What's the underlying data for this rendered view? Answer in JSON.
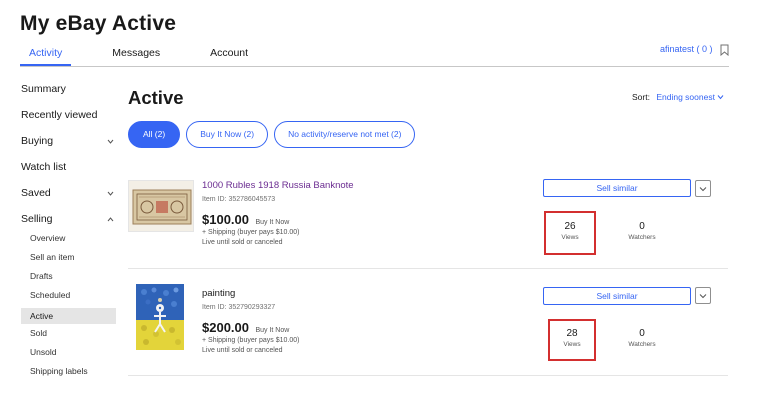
{
  "page": {
    "title": "My eBay Active"
  },
  "tabs": [
    {
      "label": "Activity",
      "active": true
    },
    {
      "label": "Messages",
      "active": false
    },
    {
      "label": "Account",
      "active": false
    }
  ],
  "user": {
    "label": "afinatest ( 0 )",
    "icon": "bookmark-icon"
  },
  "sidebar": {
    "items": [
      {
        "label": "Summary"
      },
      {
        "label": "Recently viewed"
      },
      {
        "label": "Buying",
        "icon": "chevron-down-icon"
      },
      {
        "label": "Watch list"
      },
      {
        "label": "Saved",
        "icon": "chevron-down-icon"
      },
      {
        "label": "Selling",
        "icon": "chevron-up-icon"
      }
    ],
    "selling_sub": [
      {
        "label": "Overview"
      },
      {
        "label": "Sell an item"
      },
      {
        "label": "Drafts"
      },
      {
        "label": "Scheduled"
      },
      {
        "label": "Active",
        "active": true
      },
      {
        "label": "Sold"
      },
      {
        "label": "Unsold"
      },
      {
        "label": "Shipping labels"
      }
    ]
  },
  "main": {
    "title": "Active",
    "sort_label": "Sort:",
    "sort_value": "Ending soonest",
    "filters": [
      {
        "label": "All (2)",
        "active": true
      },
      {
        "label": "Buy It Now (2)",
        "active": false
      },
      {
        "label": "No activity/reserve not met (2)",
        "active": false
      }
    ]
  },
  "listings": [
    {
      "title": "1000 Rubles 1918 Russia Banknote",
      "item_id": "Item ID: 352786045573",
      "price": "$100.00",
      "price_type": "Buy It Now",
      "shipping": "+ Shipping (buyer pays $10.00)",
      "duration": "Live until sold or canceled",
      "views": "26",
      "views_label": "Views",
      "watchers": "0",
      "watchers_label": "Watchers",
      "sell_similar": "Sell similar",
      "thumb_colors": {
        "paper": "#d8c7a3",
        "ink": "#7a5a3c",
        "accent": "#b83a2e"
      }
    },
    {
      "title": "painting",
      "item_id": "Item ID: 352790293327",
      "price": "$200.00",
      "price_type": "Buy It Now",
      "shipping": "+ Shipping (buyer pays $10.00)",
      "duration": "Live until sold or canceled",
      "views": "28",
      "views_label": "Views",
      "watchers": "0",
      "watchers_label": "Watchers",
      "sell_similar": "Sell similar",
      "thumb_colors": {
        "sky": "#2f63b8",
        "field": "#e3d43a",
        "figure": "#f4f4f4"
      }
    }
  ],
  "colors": {
    "accent": "#3665f3",
    "visited_link": "#6b2c91",
    "highlight": "#d32f2f"
  }
}
